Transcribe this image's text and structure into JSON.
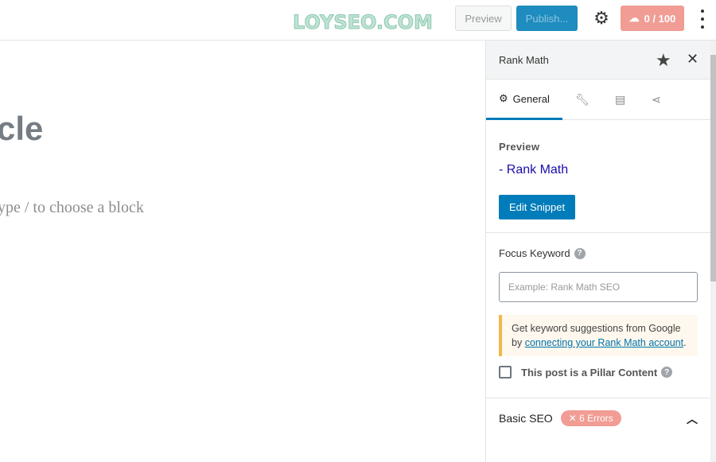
{
  "watermark": "LOYSEO.COM",
  "toolbar": {
    "preview_label": "Preview",
    "publish_label": "Publish...",
    "score_label": "0 / 100",
    "settings_icon": "gear-icon",
    "more_icon": "more-vertical-icon"
  },
  "editor": {
    "title_visible": "cle",
    "block_hint": "ype / to choose a block"
  },
  "sidebar": {
    "title": "Rank Math",
    "tabs": [
      {
        "label": "General",
        "icon": "gear-icon"
      },
      {
        "icon": "wrench-icon"
      },
      {
        "icon": "document-icon"
      },
      {
        "icon": "share-icon"
      }
    ],
    "preview": {
      "label": "Preview",
      "link": "- Rank Math",
      "edit_button": "Edit Snippet"
    },
    "focus_keyword": {
      "label": "Focus Keyword",
      "placeholder": "Example: Rank Math SEO"
    },
    "notice": {
      "text_before": "Get keyword suggestions from Google by ",
      "link": "connecting your Rank Math account",
      "text_after": "."
    },
    "pillar": {
      "label": "This post is a Pillar Content",
      "checked": false
    },
    "basic_seo": {
      "label": "Basic SEO",
      "badge": "6 Errors",
      "expanded": true
    }
  },
  "colors": {
    "accent": "#007cba",
    "score": "#f19c94",
    "notice_border": "#f0b849"
  }
}
